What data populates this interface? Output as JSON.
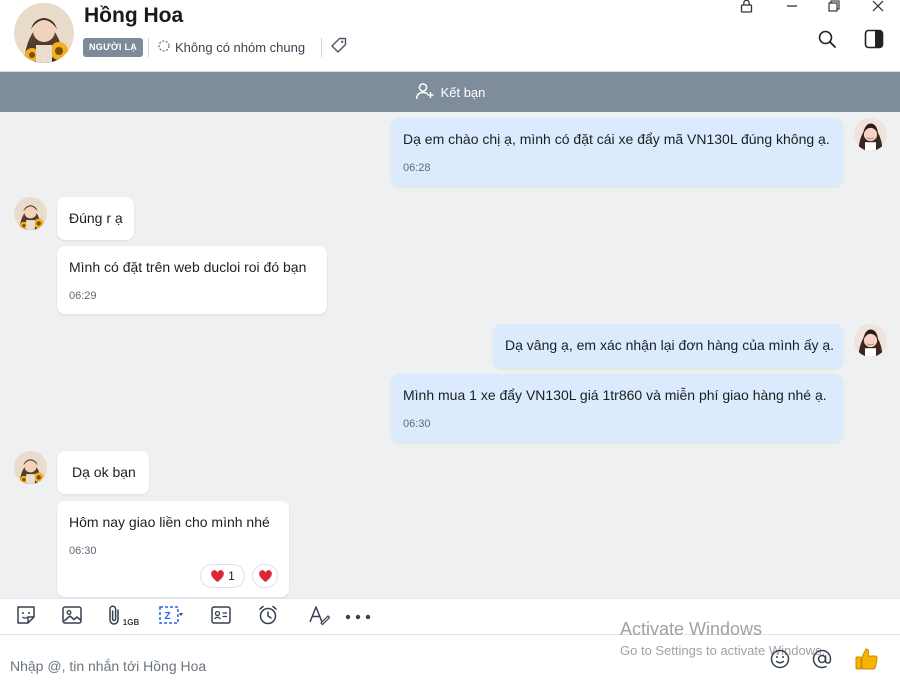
{
  "header": {
    "contact_name": "Hồng Hoa",
    "badge": "NGƯỜI LẠ",
    "group_info": "Không có nhóm chung"
  },
  "add_friend_label": "Kết bạn",
  "messages": [
    {
      "from": "me",
      "text": "Dạ em chào chị ạ, mình có đặt cái xe đẩy mã VN130L đúng không ạ.",
      "time": "06:28"
    },
    {
      "from": "contact",
      "text": "Đúng r ạ",
      "time": ""
    },
    {
      "from": "contact",
      "text": "Mình có đặt trên web ducloi roi đó bạn",
      "time": "06:29"
    },
    {
      "from": "me",
      "text": "Dạ vâng ạ, em xác nhận lại đơn hàng của mình ấy ạ.",
      "time": ""
    },
    {
      "from": "me",
      "text": "Mình mua 1 xe đẩy VN130L giá 1tr860 và miễn phí giao hàng nhé ạ.",
      "time": "06:30"
    },
    {
      "from": "contact",
      "text": "Dạ ok bạn",
      "time": ""
    },
    {
      "from": "contact",
      "text": "Hôm nay giao liền cho mình nhé",
      "time": "06:30",
      "reaction_count": "1"
    }
  ],
  "toolbar": {
    "file_size_label": "1GB"
  },
  "composer": {
    "placeholder": "Nhập @, tin nhắn tới Hồng Hoa"
  },
  "watermark": {
    "line1": "Activate Windows",
    "line2": "Go to Settings to activate Windows."
  },
  "colors": {
    "outgoing_bubble": "#dbebfd",
    "incoming_bubble": "#ffffff",
    "add_friend_bar": "#7f8c9b",
    "chat_background": "#eef0f1",
    "heart": "#e0243a",
    "like_thumb": "#f4b400"
  },
  "icons": [
    "lock-icon",
    "minimize-icon",
    "restore-icon",
    "close-icon",
    "search-icon",
    "sidebar-toggle-icon",
    "tag-icon",
    "loading-icon",
    "add-friend-icon",
    "sticker-icon",
    "image-icon",
    "attach-icon",
    "screenshot-icon",
    "contact-card-icon",
    "reminder-icon",
    "format-text-icon",
    "more-icon",
    "emoji-icon",
    "mention-icon",
    "like-icon",
    "heart-icon"
  ]
}
